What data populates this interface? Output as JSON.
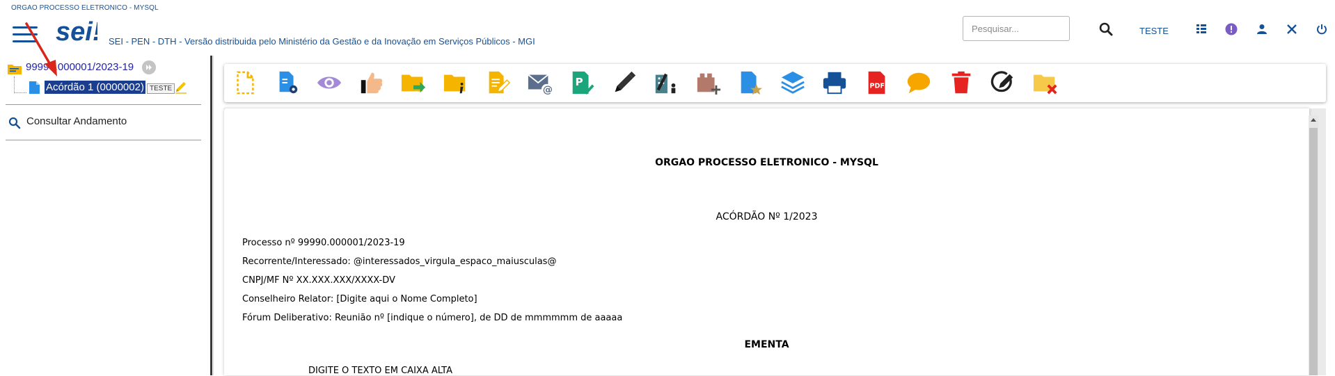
{
  "header": {
    "org_name": "ORGAO PROCESSO ELETRONICO - MYSQL",
    "logo_text": "sei!",
    "system_desc": "SEI - PEN - DTH - Versão distribuida pelo Ministério da Gestão e da Inovação em Serviços Públicos - MGI",
    "search_placeholder": "Pesquisar...",
    "unit": "TESTE",
    "icons": [
      "menu-icon",
      "search-icon",
      "grid-icon",
      "alert-icon",
      "user-icon",
      "close-tools-icon",
      "power-icon"
    ],
    "accent_color": "#155196"
  },
  "tree": {
    "process": "99990.000001/2023-19",
    "document": "Acórdão 1 (0000002)",
    "document_badge": "TESTE",
    "consult": "Consultar Andamento"
  },
  "toolbar": {
    "icons": [
      "new-document-icon",
      "process-settings-icon",
      "view-icon",
      "assign-icon",
      "send-process-icon",
      "process-info-icon",
      "edit-document-icon",
      "send-email-icon",
      "sign-icon",
      "pen-icon",
      "assign-unit-icon",
      "add-to-block-icon",
      "favorite-document-icon",
      "layers-icon",
      "print-icon",
      "pdf-icon",
      "comment-icon",
      "delete-icon",
      "checkout-icon",
      "close-process-icon"
    ],
    "pdf_label": "PDF"
  },
  "document": {
    "header": "ORGAO PROCESSO ELETRONICO - MYSQL",
    "title": "ACÓRDÃO Nº 1/2023",
    "lines": [
      "Processo nº 99990.000001/2023-19",
      "Recorrente/Interessado: @interessados_virgula_espaco_maiusculas@",
      "CNPJ/MF Nº XX.XXX.XXX/XXXX-DV",
      "Conselheiro Relator: [Digite aqui o Nome Completo]",
      "Fórum Deliberativo: Reunião nº [indique o número], de DD de mmmmmm de aaaaa"
    ],
    "section": "EMENTA",
    "body": "DIGITE O TEXTO EM CAIXA ALTA"
  }
}
